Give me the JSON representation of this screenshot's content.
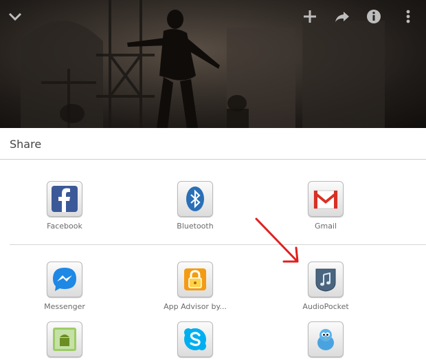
{
  "sheet": {
    "title": "Share"
  },
  "apps": [
    {
      "label": "Facebook",
      "icon": "facebook-icon"
    },
    {
      "label": "Bluetooth",
      "icon": "bluetooth-icon"
    },
    {
      "label": "Gmail",
      "icon": "gmail-icon"
    },
    {
      "label": "Messenger",
      "icon": "messenger-icon"
    },
    {
      "label": "App Advisor by...",
      "icon": "app-advisor-lock-icon"
    },
    {
      "label": "AudioPocket",
      "icon": "audiopocket-icon"
    },
    {
      "label": "",
      "icon": "android-app-icon"
    },
    {
      "label": "",
      "icon": "skype-icon"
    },
    {
      "label": "",
      "icon": "twitter-bird-icon"
    }
  ],
  "toolbar": {
    "icons": [
      "chevron-down-icon",
      "add-icon",
      "share-icon",
      "info-icon",
      "more-vert-icon"
    ]
  },
  "colors": {
    "facebook": "#3b5998",
    "bluetooth": "#2a6fb7",
    "gmail_red": "#d93025",
    "messenger": "#1e88e5",
    "advisor_orange": "#f39c12",
    "audiopocket": "#4a6580",
    "skype": "#00aff0",
    "annotation_arrow": "#e02020"
  }
}
